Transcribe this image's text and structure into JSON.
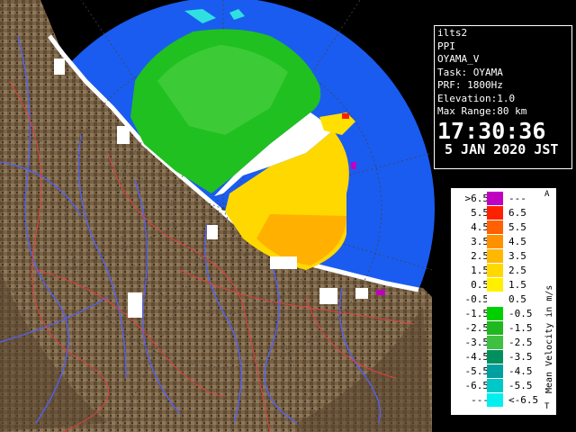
{
  "info": {
    "system": "ilts2",
    "product": "PPI",
    "product_name": "OYAMA_V",
    "task": "Task: OYAMA",
    "prf": "PRF: 1800Hz",
    "elevation": "Elevation:1.0",
    "max_range": "Max Range:80 km",
    "time": "17:30:36",
    "date": "5 JAN 2020 JST"
  },
  "legend": {
    "unit_label": "Mean Velocity in m/s",
    "corner_top": "A",
    "corner_bottom": "T",
    "rows": [
      {
        "lo": ">6.5",
        "hi": "---",
        "color": "#c000c0"
      },
      {
        "lo": "5.5",
        "hi": "6.5",
        "color": "#ff2000"
      },
      {
        "lo": "4.5",
        "hi": "5.5",
        "color": "#ff6000"
      },
      {
        "lo": "3.5",
        "hi": "4.5",
        "color": "#ff9000"
      },
      {
        "lo": "2.5",
        "hi": "3.5",
        "color": "#ffb800"
      },
      {
        "lo": "1.5",
        "hi": "2.5",
        "color": "#ffd800"
      },
      {
        "lo": "0.5",
        "hi": "1.5",
        "color": "#fff000"
      },
      {
        "lo": "-0.5",
        "hi": "0.5",
        "color": "#ffffff"
      },
      {
        "lo": "-1.5",
        "hi": "-0.5",
        "color": "#00d000"
      },
      {
        "lo": "-2.5",
        "hi": "-1.5",
        "color": "#20b820"
      },
      {
        "lo": "-3.5",
        "hi": "-2.5",
        "color": "#40c040"
      },
      {
        "lo": "-4.5",
        "hi": "-3.5",
        "color": "#009060"
      },
      {
        "lo": "-5.5",
        "hi": "-4.5",
        "color": "#00a0a0"
      },
      {
        "lo": "-6.5",
        "hi": "-5.5",
        "color": "#00c8c8"
      },
      {
        "lo": "---",
        "hi": "<-6.5",
        "color": "#00f0f0"
      }
    ]
  },
  "colors": {
    "background": "#000000",
    "coverage": "#1a5cf0",
    "terrain": "#8a7050",
    "river": "#5060ff",
    "boundary": "#e04040"
  }
}
